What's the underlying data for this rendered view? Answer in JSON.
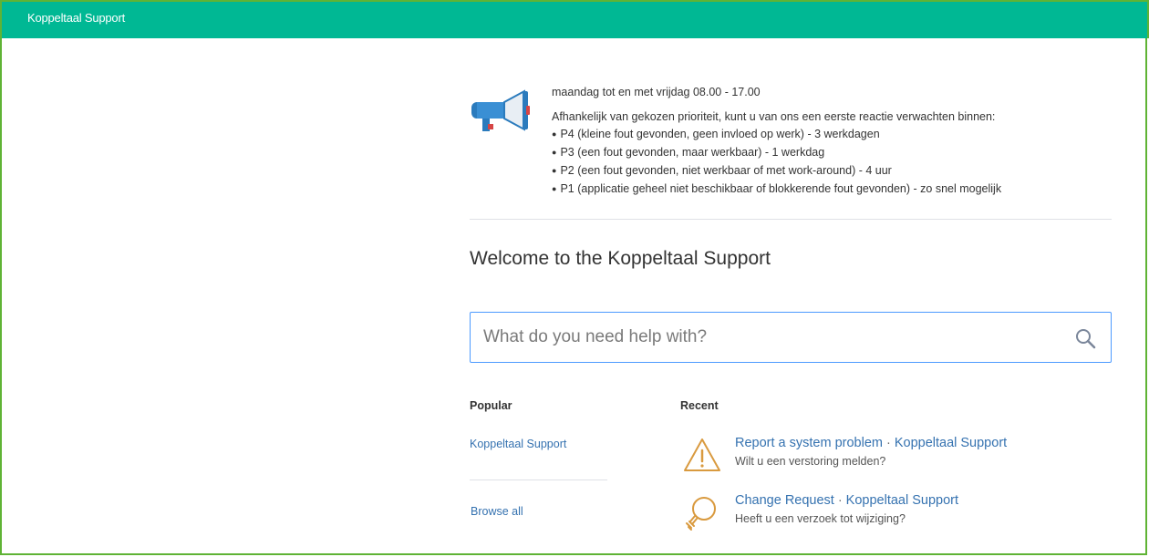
{
  "header": {
    "brand": "Koppeltaal Support"
  },
  "announcement": {
    "hours": "maandag tot en met vrijdag 08.00 - 17.00",
    "intro": "Afhankelijk van gekozen prioriteit, kunt u van ons een eerste reactie verwachten binnen:",
    "items": [
      "P4 (kleine fout gevonden, geen invloed op werk) - 3 werkdagen",
      "P3 (een fout gevonden, maar werkbaar) - 1 werkdag",
      "P2 (een fout gevonden, niet werkbaar of met work-around) - 4 uur",
      "P1 (applicatie geheel niet beschikbaar of blokkerende fout gevonden) - zo snel mogelijk"
    ]
  },
  "welcome": {
    "title": "Welcome to the Koppeltaal Support"
  },
  "search": {
    "placeholder": "What do you need help with?",
    "value": ""
  },
  "popular": {
    "title": "Popular",
    "link": "Koppeltaal Support",
    "browse_all": "Browse all"
  },
  "recent": {
    "title": "Recent",
    "items": [
      {
        "title": "Report a system problem",
        "separator": "·",
        "portal": "Koppeltaal Support",
        "desc": "Wilt u een verstoring melden?",
        "icon": "warning-icon"
      },
      {
        "title": "Change Request",
        "separator": "·",
        "portal": "Koppeltaal Support",
        "desc": "Heeft u een verzoek tot wijziging?",
        "icon": "lightbulb-icon"
      }
    ]
  },
  "colors": {
    "header_bg": "#00b894",
    "frame_border": "#5fb335",
    "link": "#3572b0",
    "focus_border": "#4c9aff",
    "icon_orange": "#d99a3f"
  }
}
